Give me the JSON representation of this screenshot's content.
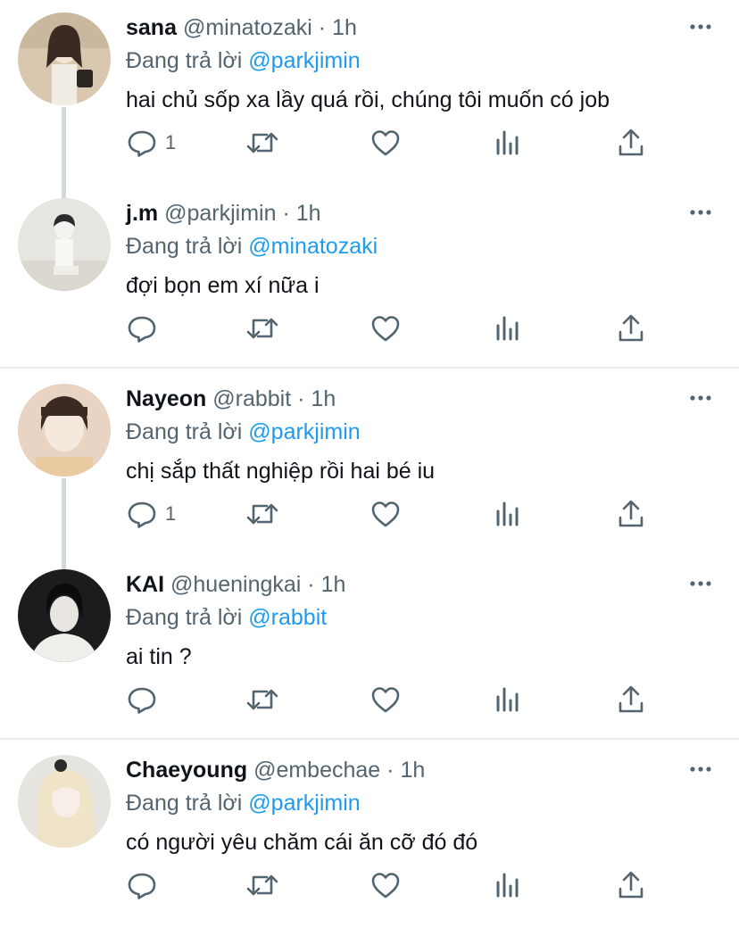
{
  "reply_prefix": "Đang trả lời",
  "tweets": [
    {
      "name": "sana",
      "handle": "@minatozaki",
      "dot": "·",
      "time": "1h",
      "replying_to": "@parkjimin",
      "text": "hai chủ sốp xa lầy quá rồi, chúng tôi muốn có job",
      "reply_count": "1",
      "avatar_colors": [
        "#d9c7b0",
        "#3a2a22",
        "#efe4d6"
      ],
      "thread_below": true
    },
    {
      "name": "j.m",
      "handle": "@parkjimin",
      "dot": "·",
      "time": "1h",
      "replying_to": "@minatozaki",
      "text": "đợi bọn em xí nữa i",
      "reply_count": "",
      "avatar_colors": [
        "#e7e5e0",
        "#2b2b2b",
        "#f4f3ef"
      ],
      "thread_below": false
    },
    {
      "name": "Nayeon",
      "handle": "@rabbit",
      "dot": "·",
      "time": "1h",
      "replying_to": "@parkjimin",
      "text": "chị sắp thất nghiệp rồi hai bé iu",
      "reply_count": "1",
      "avatar_colors": [
        "#e9d3c2",
        "#3b2a24",
        "#f5e8dc"
      ],
      "thread_below": true
    },
    {
      "name": "KAI",
      "handle": "@hueningkai",
      "dot": "·",
      "time": "1h",
      "replying_to": "@rabbit",
      "text": "ai tin ?",
      "reply_count": "",
      "avatar_colors": [
        "#1c1c1e",
        "#0c0c0d",
        "#e9e6e2"
      ],
      "thread_below": false
    },
    {
      "name": "Chaeyoung",
      "handle": "@embechae",
      "dot": "·",
      "time": "1h",
      "replying_to": "@parkjimin",
      "text": "có người yêu chăm cái ăn cỡ đó đó",
      "reply_count": "",
      "avatar_colors": [
        "#e6e4df",
        "#efe3c8",
        "#f7efe7"
      ],
      "thread_below": false
    }
  ],
  "icons": {
    "more": "more-icon",
    "reply": "reply-icon",
    "retweet": "retweet-icon",
    "like": "heart-icon",
    "views": "views-icon",
    "share": "share-icon"
  },
  "colors": {
    "mention": "#1d9bf0",
    "secondary": "#536471",
    "icon": "#536471",
    "thread": "#cfd9de"
  }
}
